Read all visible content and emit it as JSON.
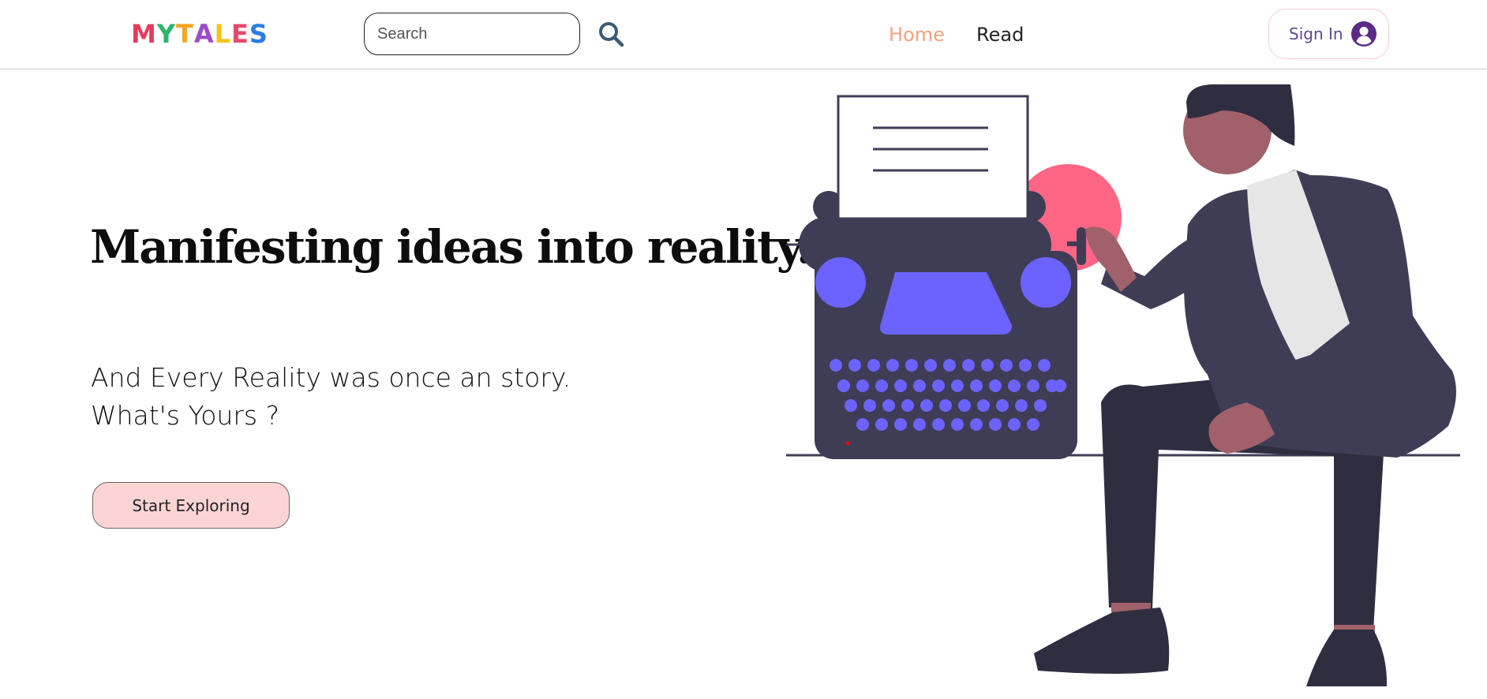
{
  "nav": {
    "logo_letters": [
      "M",
      "Y",
      "T",
      "A",
      "L",
      "E",
      "S"
    ],
    "search_placeholder": "Search",
    "search_icon": "magnifier-icon",
    "links": [
      {
        "label": "Home",
        "active": true
      },
      {
        "label": "Read",
        "active": false
      }
    ],
    "signin_label": "Sign In",
    "user_icon": "user-circle-icon"
  },
  "hero": {
    "headline": "Manifesting ideas into reality.",
    "tagline_line1": "And Every Reality was once an story.",
    "tagline_line2": "What's Yours ?",
    "cta_label": "Start Exploring"
  },
  "colors": {
    "active_link": "#f2a27e",
    "cta_background": "#fdd4d4",
    "accent_purple": "#6c63ff",
    "dark": "#3f3d56",
    "pink_circle": "#ff6584"
  }
}
